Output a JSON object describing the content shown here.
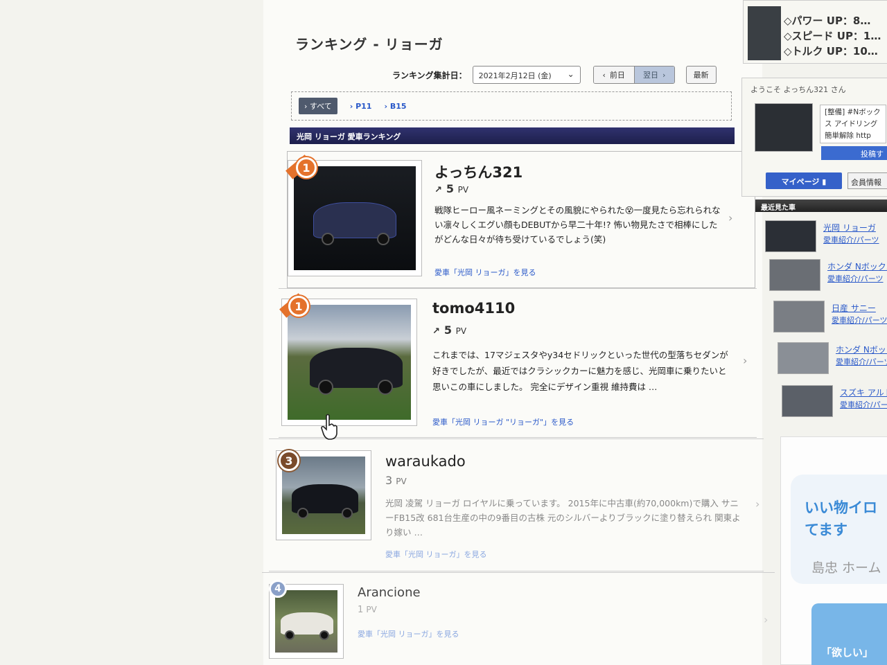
{
  "page": {
    "title": "ランキング - リョーガ",
    "date_label": "ランキング集計日：",
    "date_value": "2021年2月12日 (金)",
    "prev_label": "前日",
    "next_label": "翌日",
    "refresh_label": "最新"
  },
  "filters": {
    "all": "すべて",
    "items": [
      "P11",
      "B15"
    ]
  },
  "section_title": "光岡 リョーガ 愛車ランキング",
  "entries": [
    {
      "rank": "1",
      "user": "よっちん321",
      "pv": "5",
      "pv_unit": "PV",
      "description": "戦隊ヒーロー風ネーミングとその風貌にやられた😵一度見たら忘れられない凛々しくエグい顔もDEBUTから早二十年!? 怖い物見たさで相棒にしたがどんな日々が待ち受けているでしょう(笑)",
      "link": "愛車「光岡 リョーガ」を見る"
    },
    {
      "rank": "1",
      "user": "tomo4110",
      "pv": "5",
      "pv_unit": "PV",
      "description": "これまでは、17マジェスタやy34セドリックといった世代の型落ちセダンが好きでしたが、最近ではクラシックカーに魅力を感じ、光岡車に乗りたいと思いこの車にしました。 完全にデザイン重視 維持費は …",
      "link": "愛車「光岡 リョーガ \"リョーガ\"」を見る"
    },
    {
      "rank": "3",
      "user": "waraukado",
      "pv": "3",
      "pv_unit": "PV",
      "description": "光岡 凌駕 リョーガ ロイヤルに乗っています。 2015年に中古車(約70,000km)で購入 サニーFB15改 681台生産の中の9番目の古株 元のシルバーよりブラックに塗り替えられ 関東より嫁い …",
      "link": "愛車「光岡 リョーガ」を見る"
    },
    {
      "rank": "4",
      "user": "Arancione",
      "pv": "1",
      "pv_unit": "PV",
      "description": "",
      "link": "愛車「光岡 リョーガ」を見る"
    }
  ],
  "sidebar": {
    "ad_lines": [
      "◇パワー UP：8…",
      "◇スピード UP：1…",
      "◇トルク UP：10…"
    ],
    "welcome": "ようこそ よっちん321 さん",
    "post_text": "[整備] #Nボックス アイドリング 簡単解除 http",
    "post_button": "投稿す",
    "mypage": "マイページ",
    "member": "会員情報",
    "recent_title": "最近見た車",
    "recent": [
      {
        "name": "光岡 リョーガ",
        "sub": "愛車紹介/パーツ"
      },
      {
        "name": "ホンダ Nボックス",
        "sub": "愛車紹介/パーツ"
      },
      {
        "name": "日産 サニー",
        "sub": "愛車紹介/パーツ"
      },
      {
        "name": "ホンダ Nボックス",
        "sub": "愛車紹介/パーツ"
      },
      {
        "name": "スズキ アルト",
        "sub": "愛車紹介/パーツ"
      }
    ],
    "ad_big": "いい物イロ てます",
    "ad_shop": "島忠 ホーム",
    "ad_want": "「欲しい」"
  },
  "colors": {
    "accent_blue": "#2a59c9",
    "section_bar": "#1d1f4c",
    "rank_gold": "#e4722c",
    "rank_bronze": "#7a4a2a"
  }
}
